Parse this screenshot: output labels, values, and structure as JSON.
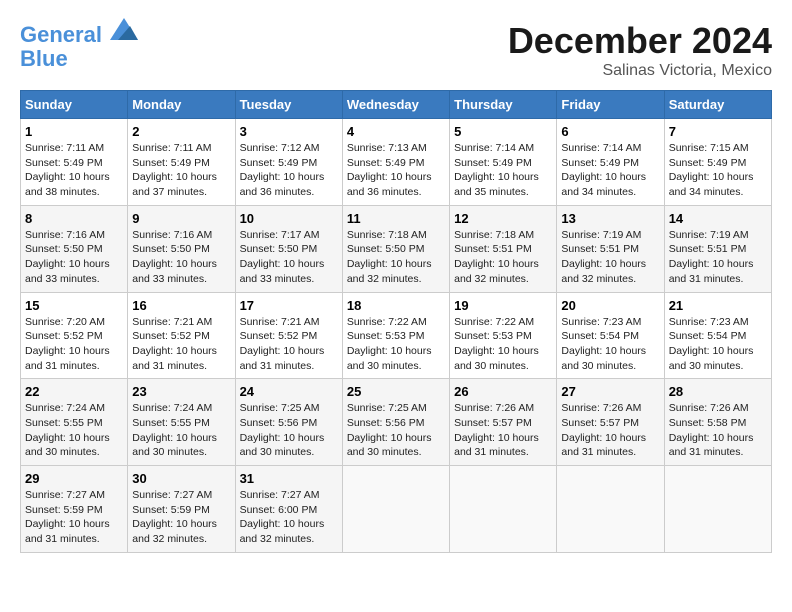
{
  "header": {
    "logo_line1": "General",
    "logo_line2": "Blue",
    "title": "December 2024",
    "subtitle": "Salinas Victoria, Mexico"
  },
  "days_of_week": [
    "Sunday",
    "Monday",
    "Tuesday",
    "Wednesday",
    "Thursday",
    "Friday",
    "Saturday"
  ],
  "weeks": [
    [
      {
        "day": "1",
        "sunrise": "7:11 AM",
        "sunset": "5:49 PM",
        "daylight": "10 hours and 38 minutes."
      },
      {
        "day": "2",
        "sunrise": "7:11 AM",
        "sunset": "5:49 PM",
        "daylight": "10 hours and 37 minutes."
      },
      {
        "day": "3",
        "sunrise": "7:12 AM",
        "sunset": "5:49 PM",
        "daylight": "10 hours and 36 minutes."
      },
      {
        "day": "4",
        "sunrise": "7:13 AM",
        "sunset": "5:49 PM",
        "daylight": "10 hours and 36 minutes."
      },
      {
        "day": "5",
        "sunrise": "7:14 AM",
        "sunset": "5:49 PM",
        "daylight": "10 hours and 35 minutes."
      },
      {
        "day": "6",
        "sunrise": "7:14 AM",
        "sunset": "5:49 PM",
        "daylight": "10 hours and 34 minutes."
      },
      {
        "day": "7",
        "sunrise": "7:15 AM",
        "sunset": "5:49 PM",
        "daylight": "10 hours and 34 minutes."
      }
    ],
    [
      {
        "day": "8",
        "sunrise": "7:16 AM",
        "sunset": "5:50 PM",
        "daylight": "10 hours and 33 minutes."
      },
      {
        "day": "9",
        "sunrise": "7:16 AM",
        "sunset": "5:50 PM",
        "daylight": "10 hours and 33 minutes."
      },
      {
        "day": "10",
        "sunrise": "7:17 AM",
        "sunset": "5:50 PM",
        "daylight": "10 hours and 33 minutes."
      },
      {
        "day": "11",
        "sunrise": "7:18 AM",
        "sunset": "5:50 PM",
        "daylight": "10 hours and 32 minutes."
      },
      {
        "day": "12",
        "sunrise": "7:18 AM",
        "sunset": "5:51 PM",
        "daylight": "10 hours and 32 minutes."
      },
      {
        "day": "13",
        "sunrise": "7:19 AM",
        "sunset": "5:51 PM",
        "daylight": "10 hours and 32 minutes."
      },
      {
        "day": "14",
        "sunrise": "7:19 AM",
        "sunset": "5:51 PM",
        "daylight": "10 hours and 31 minutes."
      }
    ],
    [
      {
        "day": "15",
        "sunrise": "7:20 AM",
        "sunset": "5:52 PM",
        "daylight": "10 hours and 31 minutes."
      },
      {
        "day": "16",
        "sunrise": "7:21 AM",
        "sunset": "5:52 PM",
        "daylight": "10 hours and 31 minutes."
      },
      {
        "day": "17",
        "sunrise": "7:21 AM",
        "sunset": "5:52 PM",
        "daylight": "10 hours and 31 minutes."
      },
      {
        "day": "18",
        "sunrise": "7:22 AM",
        "sunset": "5:53 PM",
        "daylight": "10 hours and 30 minutes."
      },
      {
        "day": "19",
        "sunrise": "7:22 AM",
        "sunset": "5:53 PM",
        "daylight": "10 hours and 30 minutes."
      },
      {
        "day": "20",
        "sunrise": "7:23 AM",
        "sunset": "5:54 PM",
        "daylight": "10 hours and 30 minutes."
      },
      {
        "day": "21",
        "sunrise": "7:23 AM",
        "sunset": "5:54 PM",
        "daylight": "10 hours and 30 minutes."
      }
    ],
    [
      {
        "day": "22",
        "sunrise": "7:24 AM",
        "sunset": "5:55 PM",
        "daylight": "10 hours and 30 minutes."
      },
      {
        "day": "23",
        "sunrise": "7:24 AM",
        "sunset": "5:55 PM",
        "daylight": "10 hours and 30 minutes."
      },
      {
        "day": "24",
        "sunrise": "7:25 AM",
        "sunset": "5:56 PM",
        "daylight": "10 hours and 30 minutes."
      },
      {
        "day": "25",
        "sunrise": "7:25 AM",
        "sunset": "5:56 PM",
        "daylight": "10 hours and 30 minutes."
      },
      {
        "day": "26",
        "sunrise": "7:26 AM",
        "sunset": "5:57 PM",
        "daylight": "10 hours and 31 minutes."
      },
      {
        "day": "27",
        "sunrise": "7:26 AM",
        "sunset": "5:57 PM",
        "daylight": "10 hours and 31 minutes."
      },
      {
        "day": "28",
        "sunrise": "7:26 AM",
        "sunset": "5:58 PM",
        "daylight": "10 hours and 31 minutes."
      }
    ],
    [
      {
        "day": "29",
        "sunrise": "7:27 AM",
        "sunset": "5:59 PM",
        "daylight": "10 hours and 31 minutes."
      },
      {
        "day": "30",
        "sunrise": "7:27 AM",
        "sunset": "5:59 PM",
        "daylight": "10 hours and 32 minutes."
      },
      {
        "day": "31",
        "sunrise": "7:27 AM",
        "sunset": "6:00 PM",
        "daylight": "10 hours and 32 minutes."
      },
      null,
      null,
      null,
      null
    ]
  ]
}
